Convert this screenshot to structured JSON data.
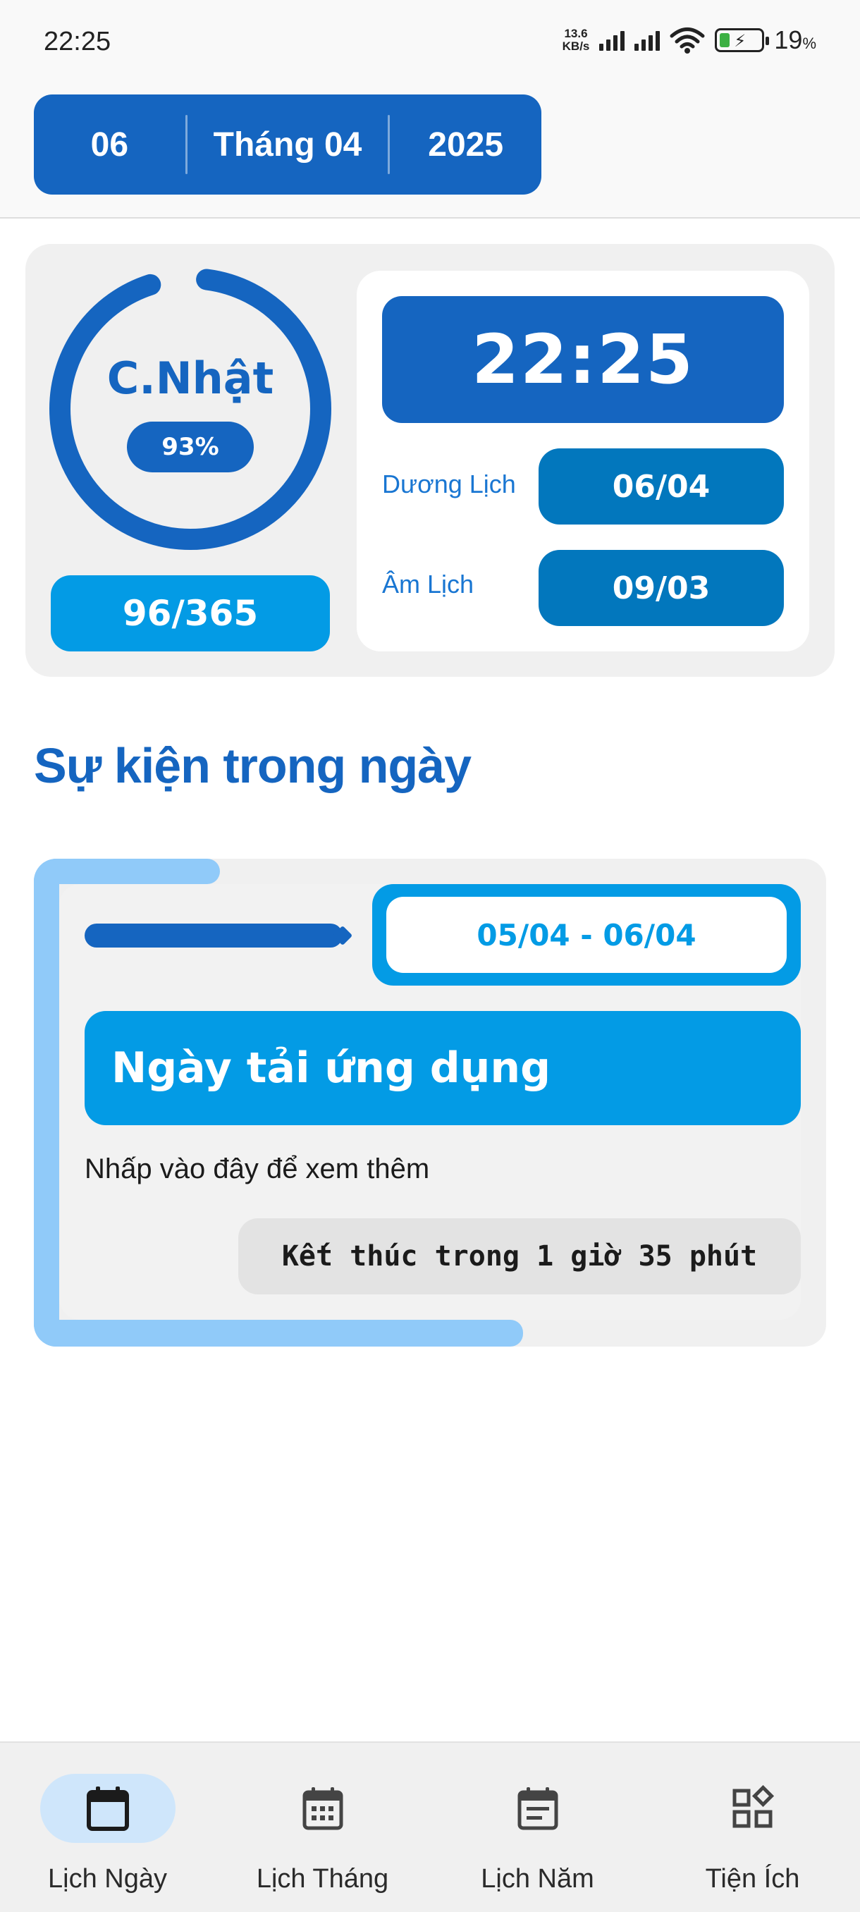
{
  "status_bar": {
    "time": "22:25",
    "net_speed_value": "13.6",
    "net_speed_unit": "KB/s",
    "battery_percent": "19",
    "battery_unit": "%"
  },
  "date_picker": {
    "day": "06",
    "month": "Tháng 04",
    "year": "2025"
  },
  "summary": {
    "weekday": "C.Nhật",
    "year_progress_label": "93%",
    "year_progress": 0.93,
    "day_of_year": "96/365",
    "clock": "22:25",
    "solar_label": "Dương Lịch",
    "solar_date": "06/04",
    "lunar_label": "Âm Lịch",
    "lunar_date": "09/03"
  },
  "events_section": {
    "title": "Sự kiện trong ngày"
  },
  "event": {
    "date_range": "05/04 - 06/04",
    "name": "Ngày tải ứng dụng",
    "hint": "Nhấp vào đây để xem thêm",
    "countdown": "Kết thúc trong 1 giờ 35 phút"
  },
  "bottom_nav": {
    "items": [
      {
        "label": "Lịch Ngày",
        "icon": "calendar-day-icon",
        "active": true
      },
      {
        "label": "Lịch Tháng",
        "icon": "calendar-month-icon",
        "active": false
      },
      {
        "label": "Lịch Năm",
        "icon": "calendar-year-icon",
        "active": false
      },
      {
        "label": "Tiện Ích",
        "icon": "widgets-icon",
        "active": false
      }
    ]
  },
  "colors": {
    "primary": "#1565c0",
    "accent": "#039be5",
    "deep": "#0277bd",
    "light_accent": "#90caf9"
  }
}
